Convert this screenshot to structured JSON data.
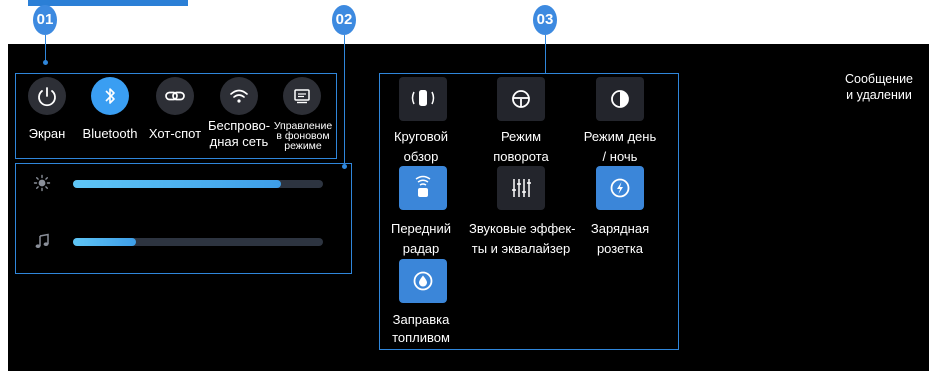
{
  "callouts": {
    "c1": "01",
    "c2": "02",
    "c3": "03"
  },
  "quick_buttons": [
    {
      "label": "Экран",
      "icon": "power-icon",
      "active": false
    },
    {
      "label": "Bluetooth",
      "icon": "bluetooth-icon",
      "active": true
    },
    {
      "label": "Хот-спот",
      "icon": "link-icon",
      "active": false
    },
    {
      "label_line1": "Беспрово-",
      "label_line2": "дная сеть",
      "icon": "wifi-icon",
      "active": false
    },
    {
      "label_line1": "Управление",
      "label_line2": "в фоновом",
      "label_line3": "режиме",
      "icon": "monitor-icon",
      "active": false
    }
  ],
  "sliders": {
    "brightness": {
      "icon": "brightness-icon",
      "level": 0.83
    },
    "volume": {
      "icon": "music-note-icon",
      "level": 0.25
    }
  },
  "apps": [
    {
      "line1": "Круговой",
      "line2": "обзор",
      "icon": "surround-view-icon"
    },
    {
      "line1": "Режим",
      "line2": "поворота",
      "icon": "steering-wheel-icon"
    },
    {
      "line1": "Режим день",
      "line2": "/ ночь",
      "icon": "day-night-icon"
    },
    {
      "line1": "Передний",
      "line2": "радар",
      "icon": "front-radar-icon"
    },
    {
      "line1": "Звуковые эффек-",
      "line2": "ты и эквалайзер",
      "icon": "equalizer-icon"
    },
    {
      "line1": "Зарядная",
      "line2": "розетка",
      "icon": "charging-icon"
    },
    {
      "line1": "Заправка",
      "line2": "топливом",
      "icon": "fuel-drop-icon"
    }
  ],
  "message": {
    "line1": "Сообщение",
    "line2": "и удалении"
  },
  "colors": {
    "accent": "#3a9ef2",
    "screen": "#000000",
    "button": "#2d2f36",
    "tile_blue": "#3b86d9"
  }
}
